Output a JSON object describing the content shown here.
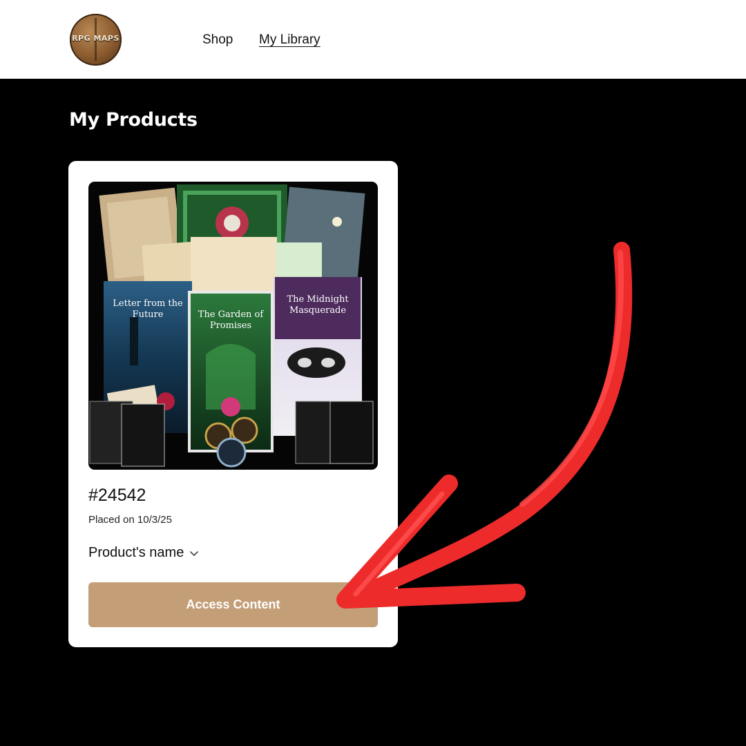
{
  "header": {
    "logo_text": "RPG MAPS",
    "nav": [
      {
        "label": "Shop",
        "active": false
      },
      {
        "label": "My Library",
        "active": true
      }
    ]
  },
  "main": {
    "title": "My Products",
    "order": {
      "number": "#24542",
      "placed_on": "Placed on 10/3/25",
      "product_name": "Product's name",
      "access_button": "Access Content",
      "image_titles": {
        "left_book": "Letter from the Future",
        "center_book": "The Garden of Promises",
        "right_book": "The Midnight Masquerade"
      }
    }
  },
  "colors": {
    "page_background": "#000000",
    "accent_button": "#c49e77",
    "annotation_arrow": "#ee2b2b"
  },
  "icons": {
    "product_dropdown": "chevron-down-icon",
    "annotation": "red-arrow-icon"
  }
}
